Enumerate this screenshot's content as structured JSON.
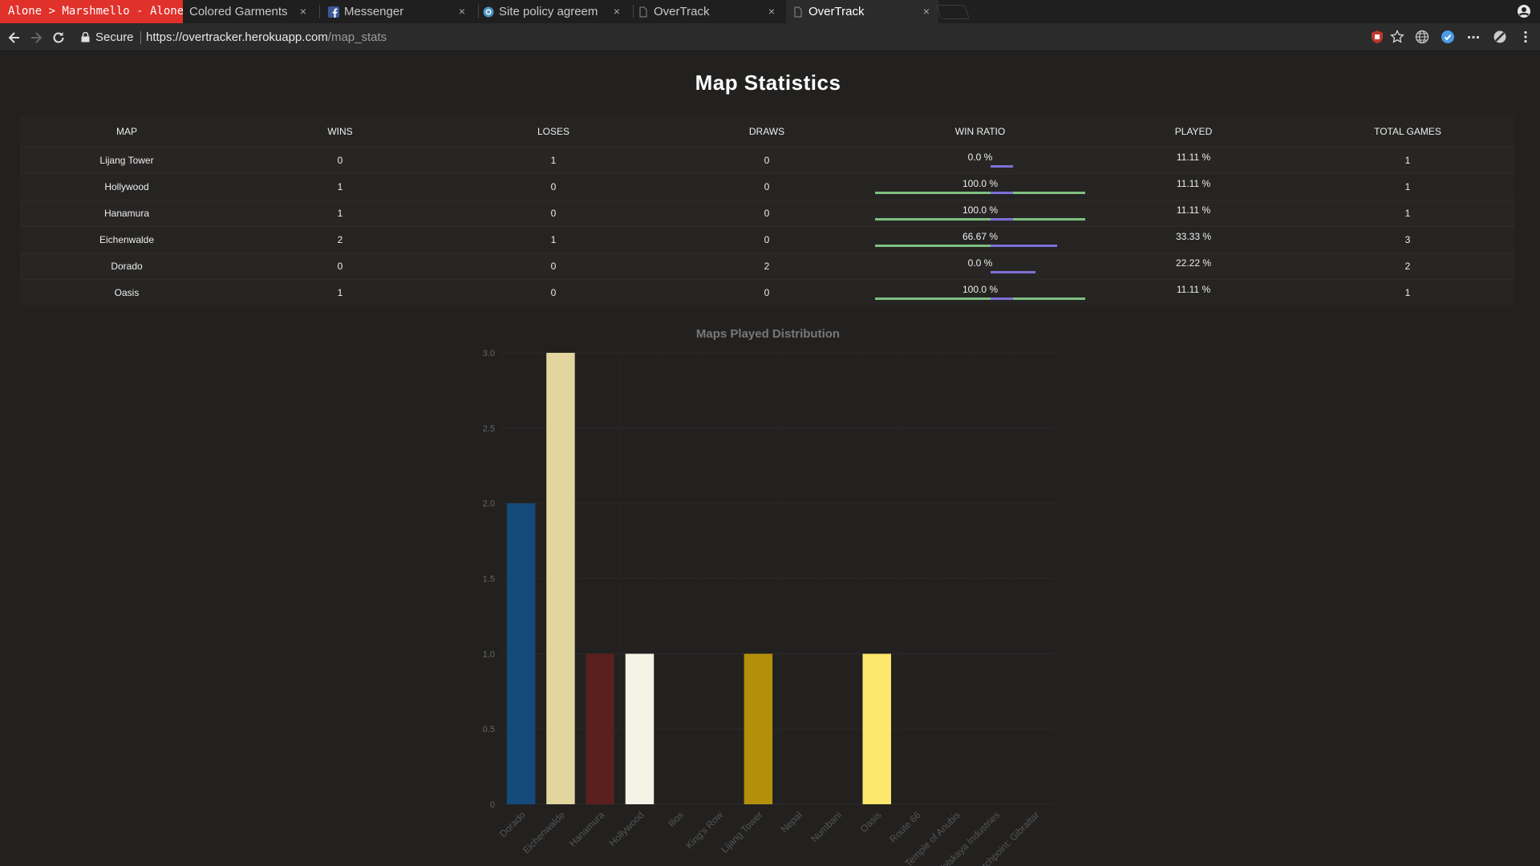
{
  "browser": {
    "now_playing": "Alone > Marshmello - Alone",
    "tabs": [
      {
        "title": "Colored Garments",
        "icon": "none",
        "close": "×"
      },
      {
        "title": "Messenger",
        "icon": "facebook-icon",
        "close": "×"
      },
      {
        "title": "Site policy agreem",
        "icon": "policy-icon",
        "close": "×"
      },
      {
        "title": "OverTrack",
        "icon": "page-icon",
        "close": "×"
      },
      {
        "title": "OverTrack",
        "icon": "page-icon",
        "close": "×",
        "active": true
      }
    ],
    "secure_label": "Secure",
    "url_host": "https://overtracker.herokuapp.com",
    "url_path": "/map_stats"
  },
  "page": {
    "title": "Map Statistics",
    "table": {
      "headers": [
        "MAP",
        "WINS",
        "LOSES",
        "DRAWS",
        "WIN RATIO",
        "PLAYED",
        "TOTAL GAMES"
      ],
      "rows": [
        {
          "map": "Lijang Tower",
          "wins": "0",
          "loses": "1",
          "draws": "0",
          "win_ratio": "0.0 %",
          "win_ratio_value": 0.0,
          "played": "11.11 %",
          "played_value": 11.11,
          "total": "1"
        },
        {
          "map": "Hollywood",
          "wins": "1",
          "loses": "0",
          "draws": "0",
          "win_ratio": "100.0 %",
          "win_ratio_value": 100.0,
          "played": "11.11 %",
          "played_value": 11.11,
          "total": "1"
        },
        {
          "map": "Hanamura",
          "wins": "1",
          "loses": "0",
          "draws": "0",
          "win_ratio": "100.0 %",
          "win_ratio_value": 100.0,
          "played": "11.11 %",
          "played_value": 11.11,
          "total": "1"
        },
        {
          "map": "Eichenwalde",
          "wins": "2",
          "loses": "1",
          "draws": "0",
          "win_ratio": "66.67 %",
          "win_ratio_value": 66.67,
          "played": "33.33 %",
          "played_value": 33.33,
          "total": "3"
        },
        {
          "map": "Dorado",
          "wins": "0",
          "loses": "0",
          "draws": "2",
          "win_ratio": "0.0 %",
          "win_ratio_value": 0.0,
          "played": "22.22 %",
          "played_value": 22.22,
          "total": "2"
        },
        {
          "map": "Oasis",
          "wins": "1",
          "loses": "0",
          "draws": "0",
          "win_ratio": "100.0 %",
          "win_ratio_value": 100.0,
          "played": "11.11 %",
          "played_value": 11.11,
          "total": "1"
        }
      ]
    },
    "colors": {
      "win_bar": "#7fbf7f",
      "played_bar": "#7d70d8"
    }
  },
  "chart_data": {
    "type": "bar",
    "title": "Maps Played Distribution",
    "categories": [
      "Dorado",
      "Eichenwalde",
      "Hanamura",
      "Hollywood",
      "Ilios",
      "King's Row",
      "Lijang Tower",
      "Nepal",
      "Numbani",
      "Oasis",
      "Route 66",
      "Temple of Anubis",
      "Volskaya Industries",
      "Watchpoint: Gibraltar"
    ],
    "values": [
      2,
      3,
      1,
      1,
      0,
      0,
      1,
      0,
      0,
      1,
      0,
      0,
      0,
      0
    ],
    "colors": [
      "#134a7a",
      "#e2d59e",
      "#5a1f1f",
      "#f5f2e6",
      "#888888",
      "#888888",
      "#b38f0a",
      "#888888",
      "#888888",
      "#fbe86c",
      "#888888",
      "#888888",
      "#888888",
      "#888888"
    ],
    "yticks": [
      "0",
      "0.5",
      "1.0",
      "1.5",
      "2.0",
      "2.5",
      "3.0"
    ],
    "ylim": [
      0,
      3
    ],
    "grid": true,
    "legend": "none"
  }
}
